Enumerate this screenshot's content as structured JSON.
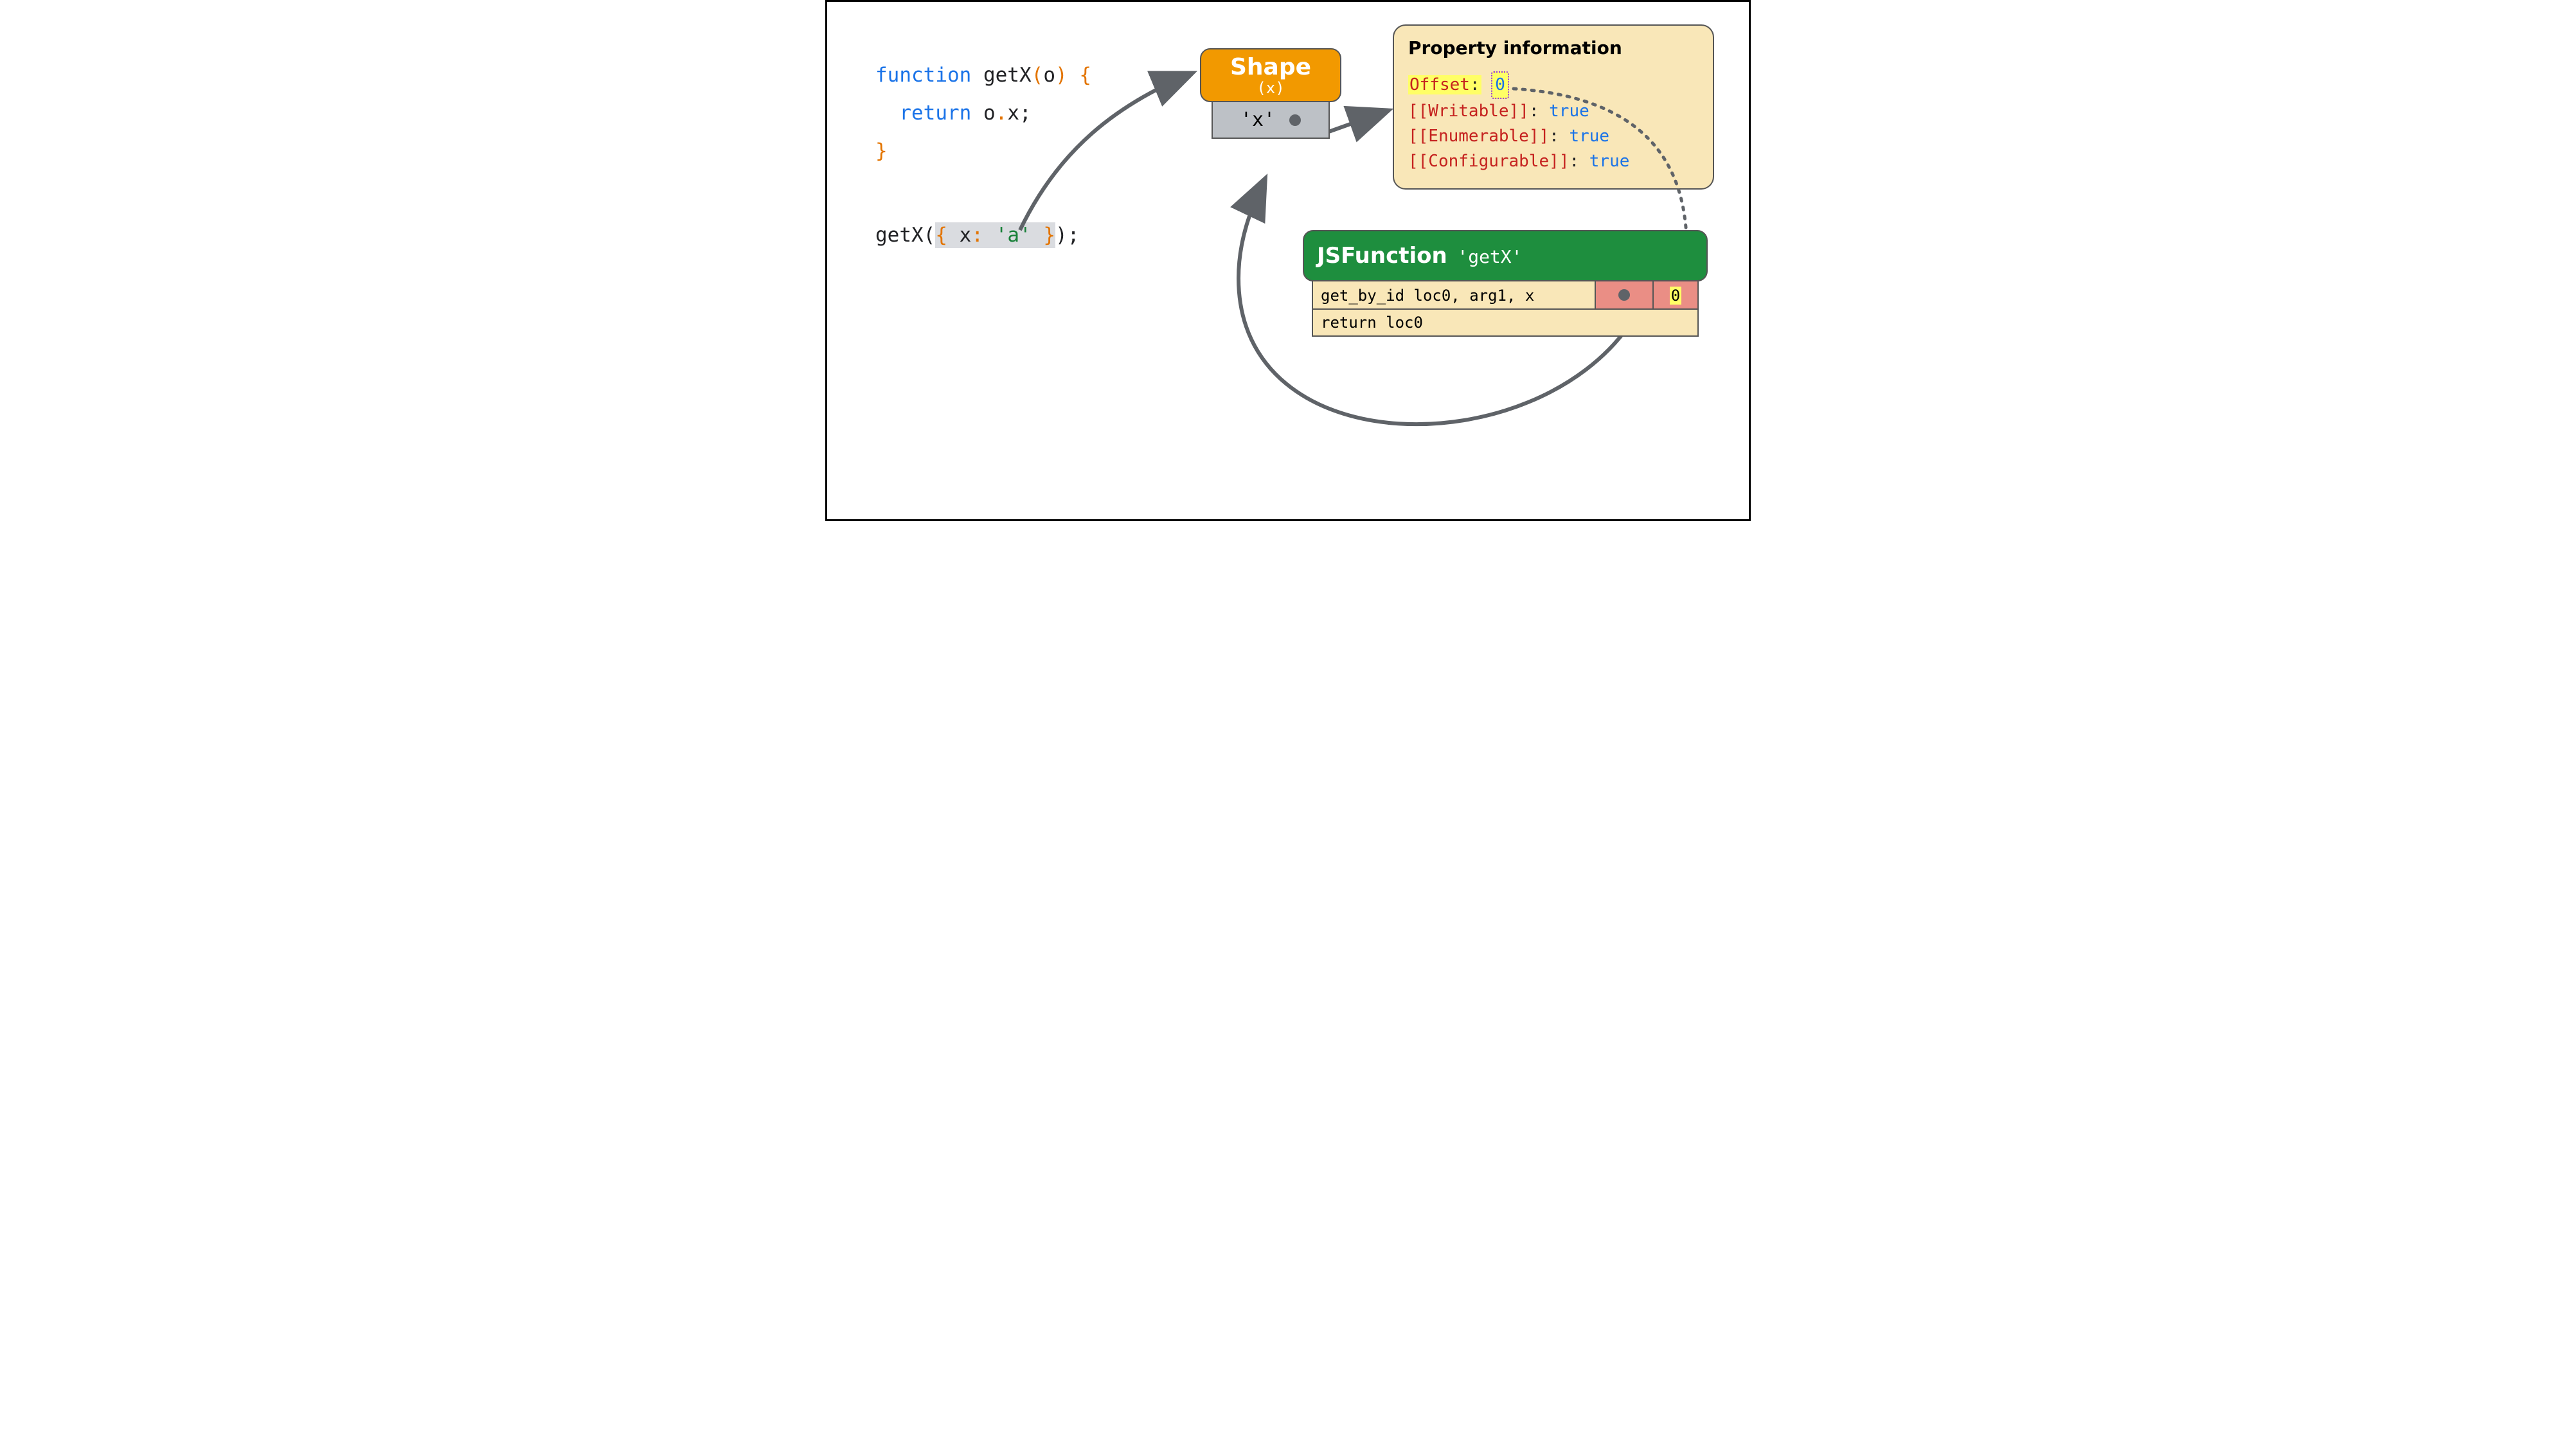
{
  "code": {
    "kw_function": "function",
    "fn_name": "getX",
    "param": "o",
    "kw_return": "return",
    "prop": "x",
    "call_name": "getX",
    "obj_key": "x",
    "obj_val": "'a'"
  },
  "shape": {
    "title": "Shape",
    "sub": "(x)",
    "entry": "'x'"
  },
  "propinfo": {
    "title": "Property information",
    "offset_label": "Offset",
    "offset_value": "0",
    "writable_label": "[[Writable]]",
    "writable_value": "true",
    "enumerable_label": "[[Enumerable]]",
    "enumerable_value": "true",
    "configurable_label": "[[Configurable]]",
    "configurable_value": "true"
  },
  "jsfunction": {
    "title": "JSFunction",
    "name": "'getX'",
    "row1": "get_by_id loc0, arg1, x",
    "row1_slot": "0",
    "row2": "return loc0"
  }
}
